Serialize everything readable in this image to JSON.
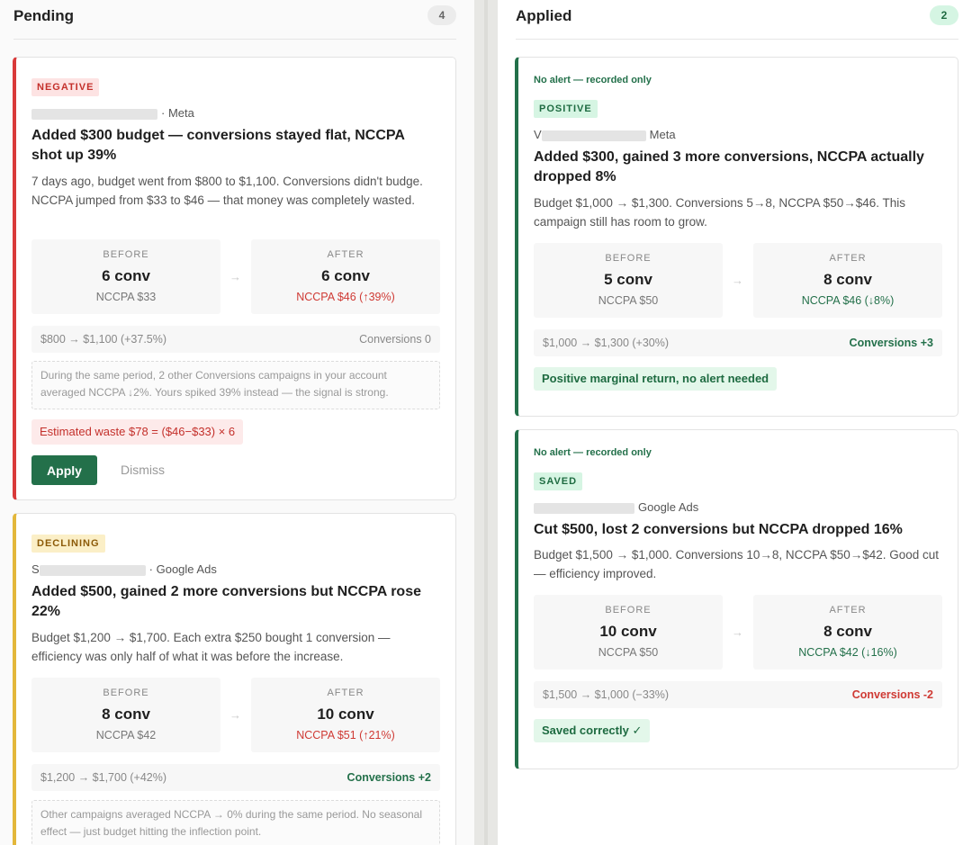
{
  "pending": {
    "title": "Pending",
    "count": "4",
    "cards": [
      {
        "tag": "NEGATIVE",
        "account": "· Meta",
        "headline": "Added $300 budget — conversions stayed flat, NCCPA shot up 39%",
        "description": "7 days ago, budget went from $800 to $1,100. Conversions didn't budge. NCCPA jumped from $33 to $46 — that money was completely wasted.",
        "before": {
          "label": "BEFORE",
          "value": "6 conv",
          "sub": "NCCPA $33"
        },
        "after": {
          "label": "AFTER",
          "value": "6 conv",
          "sub": "NCCPA $46 (↑39%)"
        },
        "budget_change": "$800 → $1,100 (+37.5%)",
        "conversions_change": "Conversions 0",
        "note": "During the same period, 2 other Conversions campaigns in your account averaged NCCPA ↓2%. Yours spiked 39% instead — the signal is strong.",
        "waste": "Estimated waste $78 = ($46−$33) × 6",
        "apply_label": "Apply",
        "dismiss_label": "Dismiss"
      },
      {
        "tag": "DECLINING",
        "account_prefix": "S",
        "account": "· Google Ads",
        "headline": "Added $500, gained 2 more conversions but NCCPA rose 22%",
        "description": "Budget $1,200 → $1,700. Each extra $250 bought 1 conversion — efficiency was only half of what it was before the increase.",
        "before": {
          "label": "BEFORE",
          "value": "8 conv",
          "sub": "NCCPA $42"
        },
        "after": {
          "label": "AFTER",
          "value": "10 conv",
          "sub": "NCCPA $51 (↑21%)"
        },
        "budget_change": "$1,200 → $1,700 (+42%)",
        "conversions_change": "Conversions +2",
        "note": "Other campaigns averaged NCCPA → 0% during the same period. No seasonal effect — just budget hitting the inflection point."
      }
    ]
  },
  "applied": {
    "title": "Applied",
    "count": "2",
    "cards": [
      {
        "status": "No alert — recorded only",
        "tag": "POSITIVE",
        "account_prefix": "V",
        "account": "Meta",
        "headline": "Added $300, gained 3 more conversions, NCCPA actually dropped 8%",
        "description": "Budget $1,000 → $1,300. Conversions 5→8, NCCPA $50→$46. This campaign still has room to grow.",
        "before": {
          "label": "BEFORE",
          "value": "5 conv",
          "sub": "NCCPA $50"
        },
        "after": {
          "label": "AFTER",
          "value": "8 conv",
          "sub": "NCCPA $46 (↓8%)"
        },
        "budget_change": "$1,000 → $1,300 (+30%)",
        "conversions_change": "Conversions +3",
        "result": "Positive marginal return, no alert needed"
      },
      {
        "status": "No alert — recorded only",
        "tag": "SAVED",
        "account": "Google Ads",
        "headline": "Cut $500, lost 2 conversions but NCCPA dropped 16%",
        "description": "Budget $1,500 → $1,000. Conversions 10→8, NCCPA $50→$42. Good cut — efficiency improved.",
        "before": {
          "label": "BEFORE",
          "value": "10 conv",
          "sub": "NCCPA $50"
        },
        "after": {
          "label": "AFTER",
          "value": "8 conv",
          "sub": "NCCPA $42 (↓16%)"
        },
        "budget_change": "$1,500 → $1,000 (−33%)",
        "conversions_change": "Conversions -2",
        "result": "Saved correctly ✓"
      }
    ]
  },
  "icons": {
    "arrow": "arrow-right-icon"
  },
  "colors": {
    "negative": "#d93a3a",
    "declining": "#e3b73b",
    "positive": "#23704a",
    "apply_button": "#23704a"
  }
}
